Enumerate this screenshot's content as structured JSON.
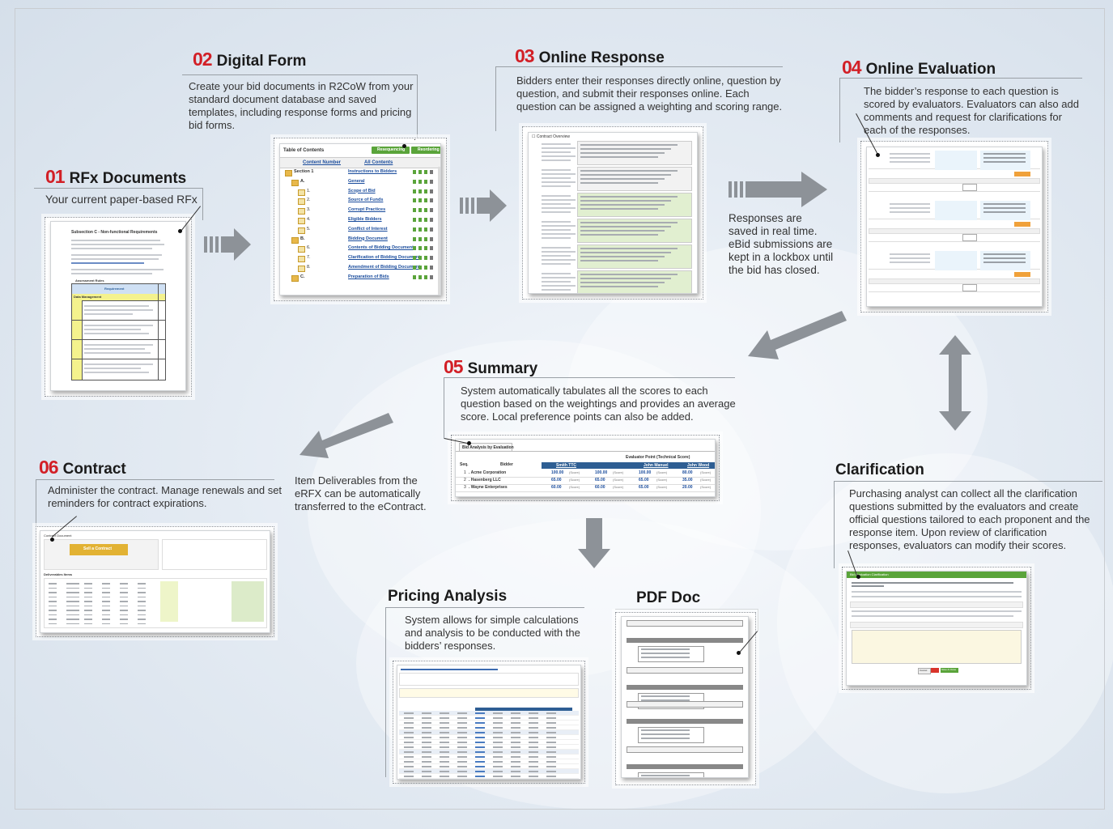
{
  "steps": {
    "rfx": {
      "num": "01",
      "title": "RFx Documents",
      "desc": "Your current paper-based RFx"
    },
    "form": {
      "num": "02",
      "title": "Digital Form",
      "desc": "Create your bid documents in R2CoW from your standard document database and saved templates, including response forms and pricing bid forms."
    },
    "response": {
      "num": "03",
      "title": "Online Response",
      "desc": "Bidders enter their responses directly online, question by question, and submit their responses online. Each question can be assigned a weighting and scoring range."
    },
    "evaluation": {
      "num": "04",
      "title": "Online Evaluation",
      "desc": "The bidder’s response to each question is scored by evaluators. Evaluators can also add comments and request for clarifications for each of the responses."
    },
    "summary": {
      "num": "05",
      "title": "Summary",
      "desc": "System automatically tabulates all the scores to each question based on the weightings and provides an average score. Local preference points can also be added."
    },
    "contract": {
      "num": "06",
      "title": "Contract",
      "desc": "Administer the contract.  Manage renewals and set reminders for contract expirations."
    },
    "clarification": {
      "title": "Clarification",
      "desc": "Purchasing analyst can collect all the clarification questions submitted by the evaluators and create official questions tailored to each proponent and the response item. Upon review of clarification responses, evaluators can modify their scores."
    },
    "pricing": {
      "title": "Pricing Analysis",
      "desc": "System allows for simple calculations and analysis to be conducted with the bidders’ responses."
    },
    "pdf": {
      "title": "PDF Doc"
    }
  },
  "notes": {
    "lockbox": "Responses are saved in real time. eBid submissions are kept in a lockbox until the bid has closed.",
    "deliverables": "Item Deliverables from the eRFX can be automatically transferred to the eContract."
  },
  "form_shot": {
    "title": "Table of Contents",
    "btn_resequence": "Resequencing",
    "btn_reorder": "Reordering",
    "col_num": "Content Number",
    "col_content": "All Contents",
    "rows": [
      {
        "num": "Section 1",
        "label": "Instructions to Bidders"
      },
      {
        "num": "A.",
        "label": "General"
      },
      {
        "num": "1.",
        "label": "Scope of Bid"
      },
      {
        "num": "2.",
        "label": "Source of Funds"
      },
      {
        "num": "3.",
        "label": "Corrupt Practices"
      },
      {
        "num": "4.",
        "label": "Eligible Bidders"
      },
      {
        "num": "5.",
        "label": "Conflict of Interest"
      },
      {
        "num": "B.",
        "label": "Bidding Document"
      },
      {
        "num": "6.",
        "label": "Contents of Bidding Document"
      },
      {
        "num": "7.",
        "label": "Clarification of Bidding Document"
      },
      {
        "num": "8.",
        "label": "Amendment of Bidding Document"
      },
      {
        "num": "C.",
        "label": "Preparation of Bids"
      }
    ]
  },
  "summary_shot": {
    "tab": "Bid Analysis by Evaluation",
    "col_seq": "Seq.",
    "col_bidder": "Bidder",
    "group_header": "Evaluator Point (Technical Score)",
    "evaluators": [
      "Smith TTC",
      "",
      "John Manuel",
      "John Wood"
    ],
    "rows": [
      {
        "seq": "1",
        "bidder": "Acme Corporation",
        "scores": [
          "100.00",
          "100.00",
          "100.00",
          "80.00"
        ]
      },
      {
        "seq": "2",
        "bidder": "Hasenberg LLC",
        "scores": [
          "65.00",
          "65.00",
          "65.00",
          "35.00"
        ]
      },
      {
        "seq": "3",
        "bidder": "Wayne Enterprises",
        "scores": [
          "60.00",
          "60.00",
          "65.00",
          "20.00"
        ]
      }
    ],
    "score_suffix": "(Score)"
  },
  "rfx_shot": {
    "heading": "Subsection C - Non-functional Requirements",
    "table_title": "Assessment Rules",
    "col_requirement": "Requirement",
    "section": "Data Management"
  },
  "contract_shot": {
    "title": "Contract Document",
    "button": "Sell a Contract",
    "deliverables": "Deliverables Items"
  },
  "clarif_shot": {
    "title": "Bid Evaluation Clarification",
    "cancel": "Cancel",
    "send": "Save & Close"
  },
  "colors": {
    "accent_red": "#d21f26",
    "arrow_gray": "#8d9298",
    "green": "#5aa43a",
    "blue_header": "#2e5e93"
  }
}
